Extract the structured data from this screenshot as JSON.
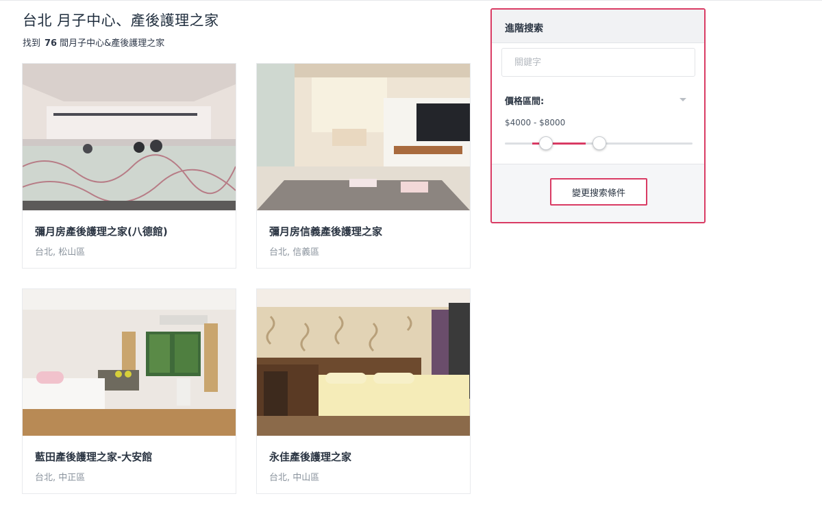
{
  "header": {
    "title": "台北 月子中心、產後護理之家",
    "result_prefix": "找到",
    "result_count": "76",
    "result_suffix": "間月子中心&產後護理之家"
  },
  "listings": [
    {
      "name": "彌月房產後護理之家(八德館)",
      "location": "台北, 松山區"
    },
    {
      "name": "彌月房信義產後護理之家",
      "location": "台北, 信義區"
    },
    {
      "name": "藍田產後護理之家-大安館",
      "location": "台北, 中正區"
    },
    {
      "name": "永佳產後護理之家",
      "location": "台北, 中山區"
    }
  ],
  "search": {
    "title": "進階搜索",
    "keyword_placeholder": "關鍵字",
    "keyword_value": "",
    "price_label": "價格區間:",
    "price_range": "$4000  -  $8000",
    "submit_label": "變更搜索條件"
  },
  "colors": {
    "accent": "#d93a63",
    "panel_bg": "#f5f6f8",
    "text": "#2a3442",
    "muted": "#8a939d"
  }
}
